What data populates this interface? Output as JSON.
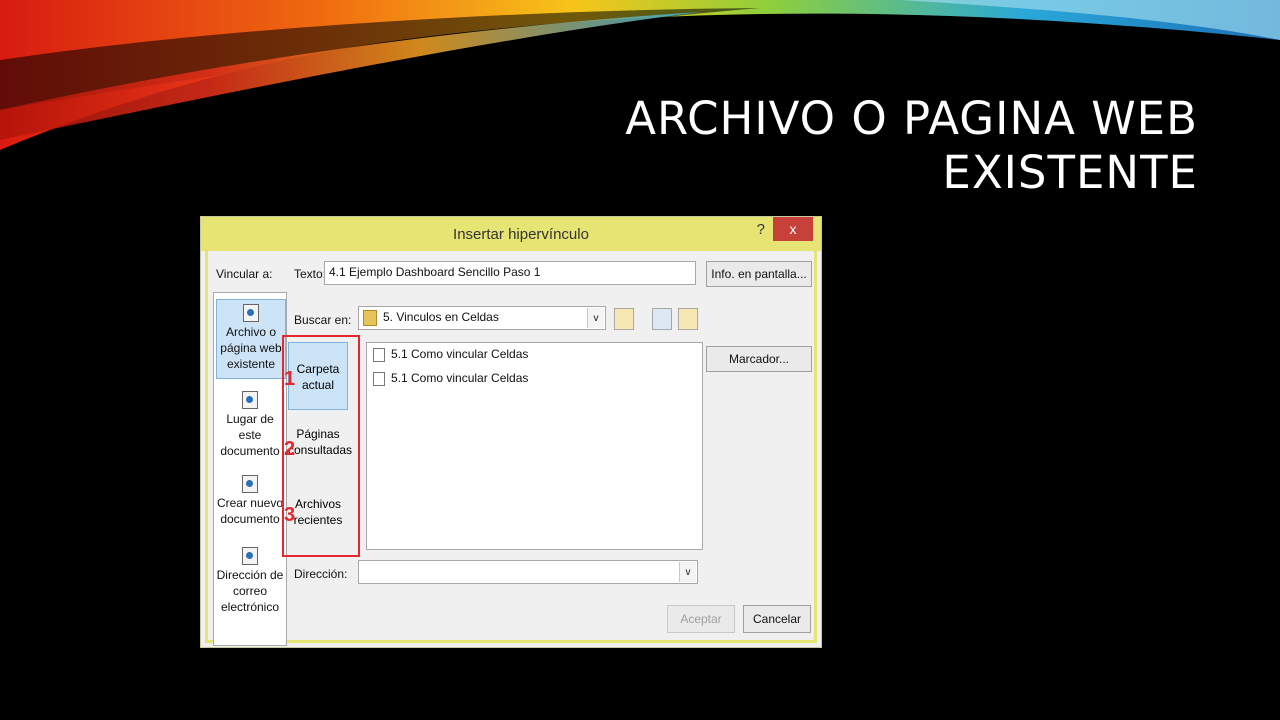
{
  "slide": {
    "title_line1": "ARCHIVO O PAGINA WEB",
    "title_line2": "EXISTENTE"
  },
  "dialog": {
    "title": "Insertar hipervínculo",
    "help_label": "?",
    "close_label": "x",
    "vincular_label": "Vincular a:",
    "texto_label": "Texto:",
    "texto_value": "4.1 Ejemplo Dashboard Sencillo Paso 1",
    "info_button": "Info. en pantalla...",
    "buscar_label": "Buscar en:",
    "buscar_value": "5. Vinculos en Celdas",
    "marcador_button": "Marcador...",
    "direccion_label": "Dirección:",
    "direccion_value": "",
    "aceptar_button": "Aceptar",
    "cancelar_button": "Cancelar",
    "link_types": [
      {
        "label": "Archivo o página web existente",
        "icon": "globe-file-icon",
        "selected": true
      },
      {
        "label": "Lugar de este documento",
        "icon": "document-place-icon",
        "selected": false
      },
      {
        "label": "Crear nuevo documento",
        "icon": "new-document-icon",
        "selected": false
      },
      {
        "label": "Dirección de correo electrónico",
        "icon": "email-icon",
        "selected": false
      }
    ],
    "nav_items": [
      {
        "label": "Carpeta actual",
        "marker": "1",
        "selected": true
      },
      {
        "label": "Páginas consultadas",
        "marker": "2",
        "selected": false
      },
      {
        "label": "Archivos recientes",
        "marker": "3",
        "selected": false
      }
    ],
    "files": [
      {
        "name": "5.1 Como vincular Celdas",
        "icon": "excel-file-icon"
      },
      {
        "name": "5.1 Como vincular Celdas",
        "icon": "excel-file-icon"
      }
    ],
    "colors": {
      "title_bar": "#e6e472",
      "close_button": "#c7413a",
      "highlight": "#e8262e",
      "selection": "#cde4f7"
    }
  }
}
